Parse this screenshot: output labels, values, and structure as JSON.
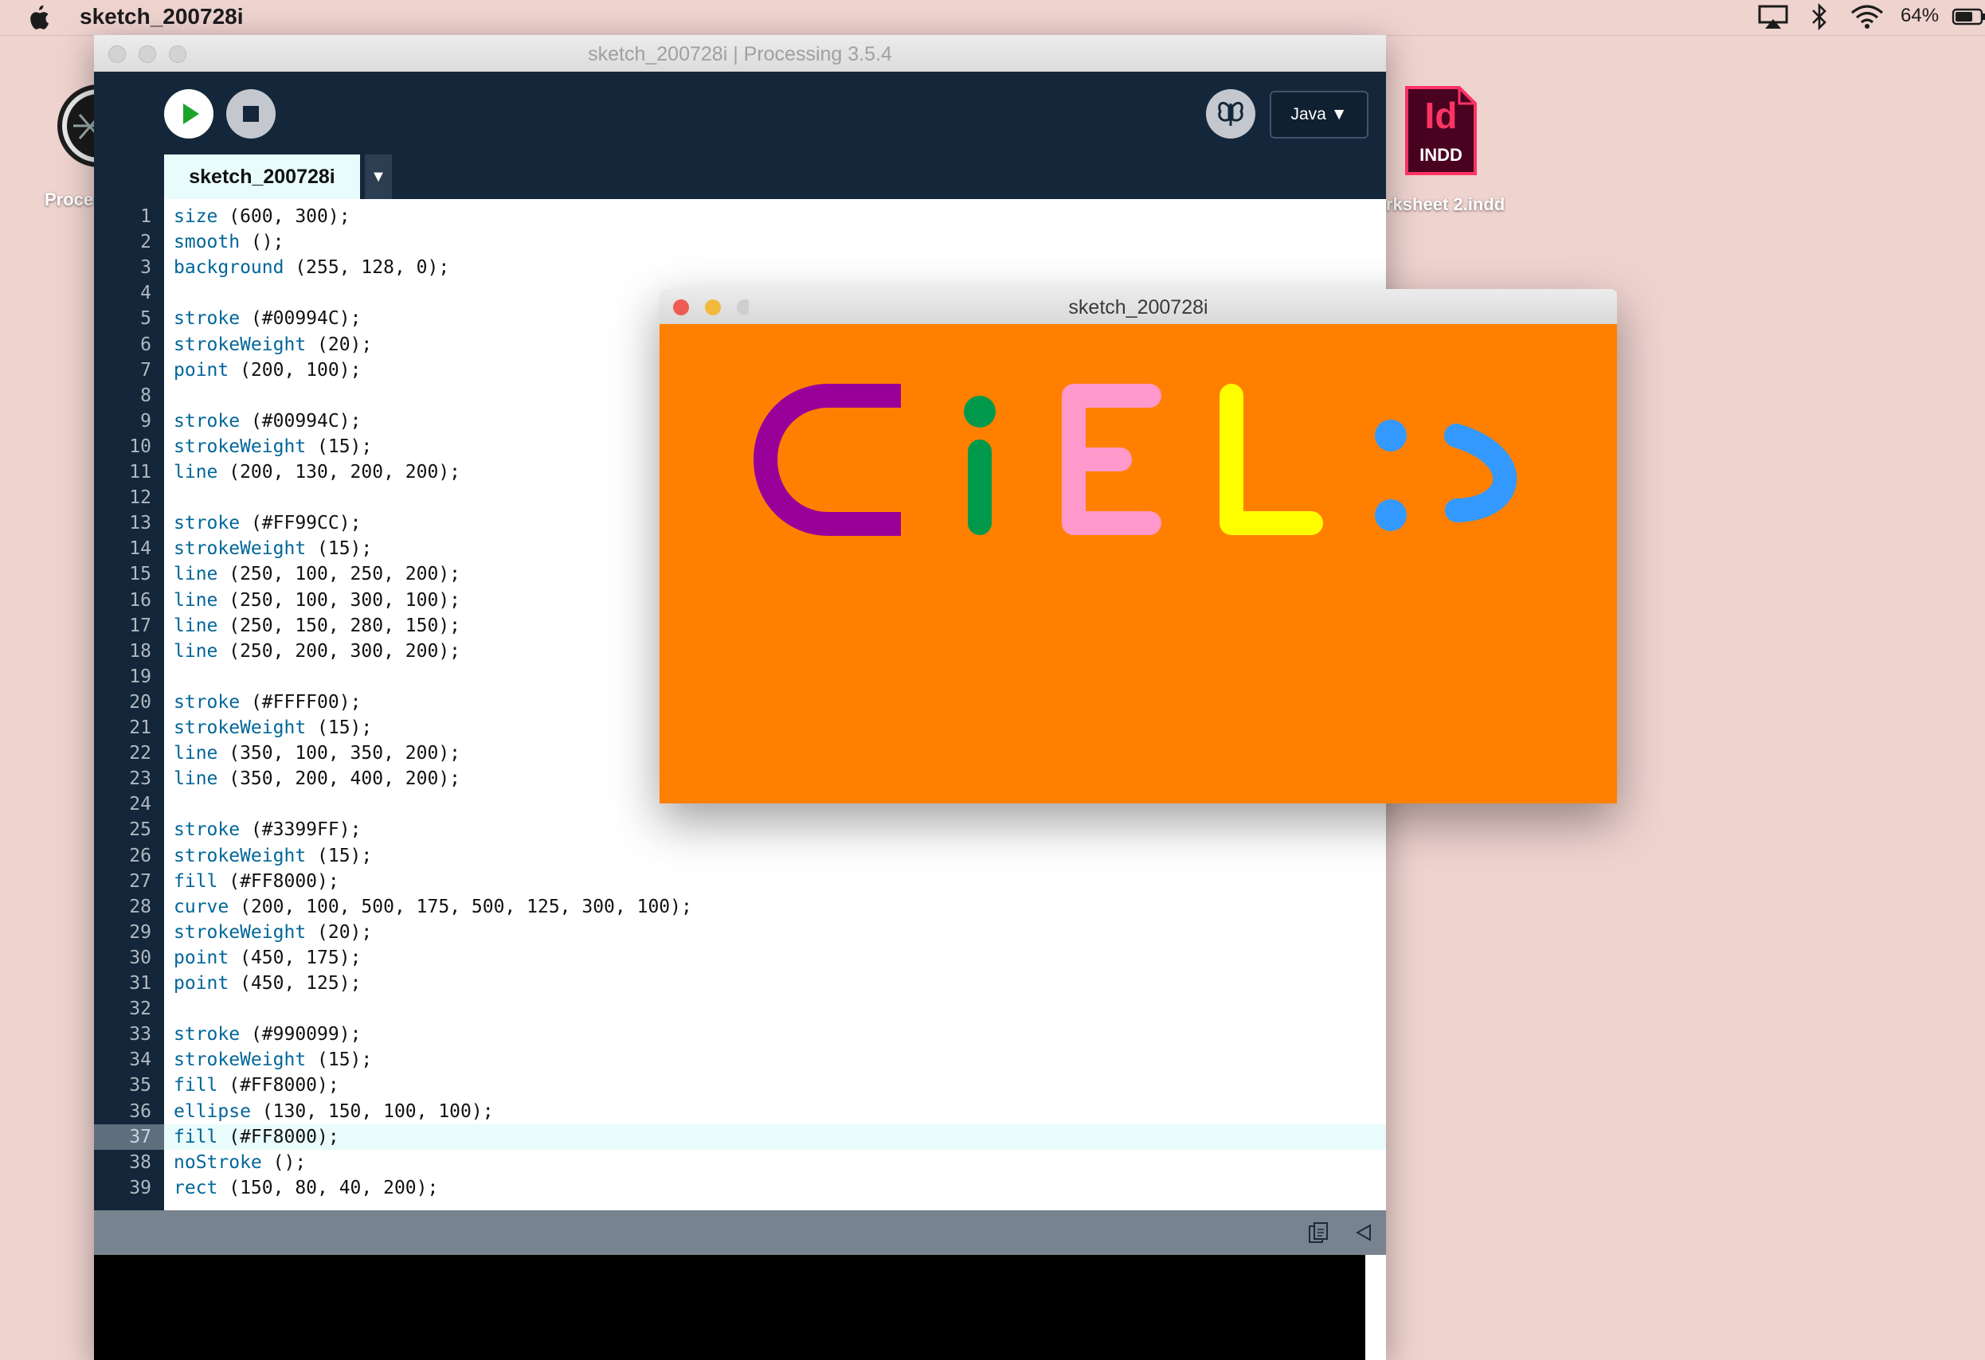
{
  "menubar": {
    "app_name": "sketch_200728i",
    "battery_percent": "64%"
  },
  "desktop": {
    "icons": [
      {
        "label": "Proce",
        "icon": "processing-app-icon"
      },
      {
        "label": "rksheet 2.indd",
        "icon": "indesign-file-icon",
        "badge_top": "Id",
        "badge_bottom": "INDD"
      }
    ]
  },
  "ide": {
    "title": "sketch_200728i | Processing 3.5.4",
    "tab_label": "sketch_200728i",
    "tab_menu": "▼",
    "mode_label": "Java ▼",
    "current_line": 37,
    "code": [
      {
        "n": "1",
        "fn": "size",
        "rest": " (600, 300);"
      },
      {
        "n": "2",
        "fn": "smooth",
        "rest": " ();"
      },
      {
        "n": "3",
        "fn": "background",
        "rest": " (255, 128, 0);"
      },
      {
        "n": "4",
        "fn": "",
        "rest": ""
      },
      {
        "n": "5",
        "fn": "stroke",
        "rest": " (#00994C);"
      },
      {
        "n": "6",
        "fn": "strokeWeight",
        "rest": " (20);"
      },
      {
        "n": "7",
        "fn": "point",
        "rest": " (200, 100);"
      },
      {
        "n": "8",
        "fn": "",
        "rest": ""
      },
      {
        "n": "9",
        "fn": "stroke",
        "rest": " (#00994C);"
      },
      {
        "n": "10",
        "fn": "strokeWeight",
        "rest": " (15);"
      },
      {
        "n": "11",
        "fn": "line",
        "rest": " (200, 130, 200, 200);"
      },
      {
        "n": "12",
        "fn": "",
        "rest": ""
      },
      {
        "n": "13",
        "fn": "stroke",
        "rest": " (#FF99CC);"
      },
      {
        "n": "14",
        "fn": "strokeWeight",
        "rest": " (15);"
      },
      {
        "n": "15",
        "fn": "line",
        "rest": " (250, 100, 250, 200);"
      },
      {
        "n": "16",
        "fn": "line",
        "rest": " (250, 100, 300, 100);"
      },
      {
        "n": "17",
        "fn": "line",
        "rest": " (250, 150, 280, 150);"
      },
      {
        "n": "18",
        "fn": "line",
        "rest": " (250, 200, 300, 200);"
      },
      {
        "n": "19",
        "fn": "",
        "rest": ""
      },
      {
        "n": "20",
        "fn": "stroke",
        "rest": " (#FFFF00);"
      },
      {
        "n": "21",
        "fn": "strokeWeight",
        "rest": " (15);"
      },
      {
        "n": "22",
        "fn": "line",
        "rest": " (350, 100, 350, 200);"
      },
      {
        "n": "23",
        "fn": "line",
        "rest": " (350, 200, 400, 200);"
      },
      {
        "n": "24",
        "fn": "",
        "rest": ""
      },
      {
        "n": "25",
        "fn": "stroke",
        "rest": " (#3399FF);"
      },
      {
        "n": "26",
        "fn": "strokeWeight",
        "rest": " (15);"
      },
      {
        "n": "27",
        "fn": "fill",
        "rest": " (#FF8000);"
      },
      {
        "n": "28",
        "fn": "curve",
        "rest": " (200, 100, 500, 175, 500, 125, 300, 100);"
      },
      {
        "n": "29",
        "fn": "strokeWeight",
        "rest": " (20);"
      },
      {
        "n": "30",
        "fn": "point",
        "rest": " (450, 175);"
      },
      {
        "n": "31",
        "fn": "point",
        "rest": " (450, 125);"
      },
      {
        "n": "32",
        "fn": "",
        "rest": ""
      },
      {
        "n": "33",
        "fn": "stroke",
        "rest": " (#990099);"
      },
      {
        "n": "34",
        "fn": "strokeWeight",
        "rest": " (15);"
      },
      {
        "n": "35",
        "fn": "fill",
        "rest": " (#FF8000);"
      },
      {
        "n": "36",
        "fn": "ellipse",
        "rest": " (130, 150, 100, 100);"
      },
      {
        "n": "37",
        "fn": "fill",
        "rest": " (#FF8000);"
      },
      {
        "n": "38",
        "fn": "noStroke",
        "rest": " ();"
      },
      {
        "n": "39",
        "fn": "rect",
        "rest": " (150, 80, 40, 200);"
      }
    ]
  },
  "sketch_window": {
    "title": "sketch_200728i",
    "background": "#FF8000",
    "colors": {
      "purple": "#990099",
      "green": "#00994C",
      "pink": "#FF99CC",
      "yellow": "#FFFF00",
      "blue": "#3399FF"
    }
  }
}
